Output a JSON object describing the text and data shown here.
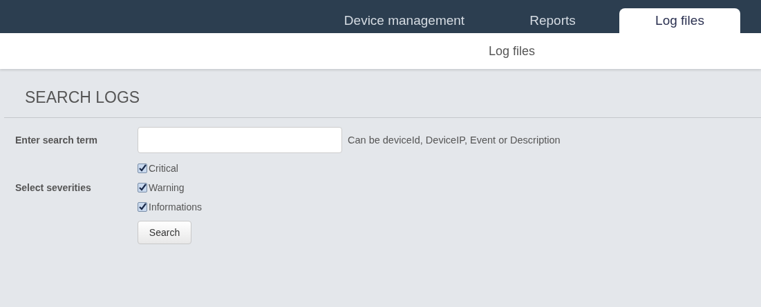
{
  "nav_tabs": [
    {
      "label": "Device management",
      "selected": false
    },
    {
      "label": "Reports",
      "selected": false
    },
    {
      "label": "Log files",
      "selected": true
    }
  ],
  "sub_nav": {
    "label": "Log files"
  },
  "section_title": "SEARCH LOGS",
  "search": {
    "label": "Enter search term",
    "hint": "Can be deviceId, DeviceIP, Event or Description"
  },
  "severities": {
    "label": "Select severities",
    "options": [
      {
        "label": "Critical",
        "checked": true
      },
      {
        "label": "Warning",
        "checked": true
      },
      {
        "label": "Informations",
        "checked": true
      }
    ]
  },
  "search_button": "Search"
}
